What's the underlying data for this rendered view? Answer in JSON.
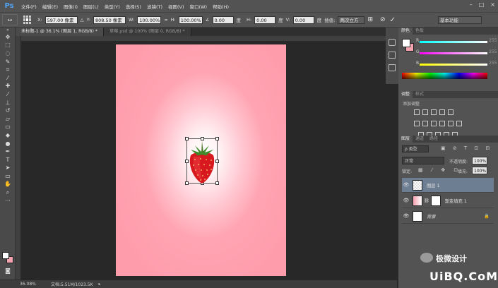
{
  "app": {
    "logo": "Ps"
  },
  "menu": [
    "文件(F)",
    "编辑(E)",
    "图像(I)",
    "图层(L)",
    "类型(Y)",
    "选择(S)",
    "滤镜(T)",
    "视图(V)",
    "窗口(W)",
    "帮助(H)"
  ],
  "window_controls": [
    "–",
    "□",
    "×"
  ],
  "options": {
    "x_label": "X:",
    "x_value": "597.00 像素",
    "y_label": "Y:",
    "y_value": "808.50 像素",
    "w_label": "W:",
    "w_value": "100.00%",
    "link_symbol": "∞",
    "h_label": "H:",
    "h_value": "100.00%",
    "angle_value": "0.00",
    "angle_unit": "度",
    "hskew_label": "H:",
    "hskew_value": "0.00",
    "hskew_unit": "度",
    "vskew_label": "V:",
    "vskew_value": "0.00",
    "vskew_unit": "度",
    "interp_label": "插值:",
    "interp_value": "两次立方",
    "workspace": "基本功能"
  },
  "tabs": [
    "未标题-1 @ 36.1% (图层 1, RGB/8) *",
    "草莓.psd @ 100% (图层 0, RGB/8) *"
  ],
  "status": {
    "zoom": "36.08%",
    "doc_info": "文档:5.51M/1023.5K"
  },
  "color_panel": {
    "tabs": [
      "颜色",
      "色板"
    ],
    "channels": [
      {
        "label": "R",
        "value": "255"
      },
      {
        "label": "G",
        "value": "255"
      },
      {
        "label": "B",
        "value": "255"
      }
    ],
    "fg_color": "#ffffff",
    "bg_color": "#f5a3ae"
  },
  "adjust_panel": {
    "tabs": [
      "调整",
      "样式"
    ],
    "subtitle": "添加调整"
  },
  "layers_panel": {
    "tabs": [
      "图层",
      "通道",
      "路径"
    ],
    "filter": "ρ 类型",
    "blend_mode": "正常",
    "opacity_label": "不透明度:",
    "opacity_value": "100%",
    "lock_label": "锁定:",
    "fill_label": "填充:",
    "fill_value": "100%",
    "layers": [
      {
        "name": "图层 1",
        "selected": true
      },
      {
        "name": "渐变填充 1",
        "selected": false
      },
      {
        "name": "背景",
        "selected": false
      }
    ]
  },
  "watermark": {
    "brand": "极微设计",
    "site": "UiBQ.CoM"
  }
}
